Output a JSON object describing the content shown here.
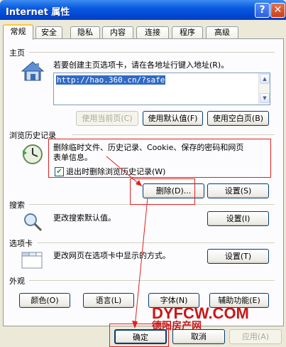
{
  "window": {
    "title": "Internet 属性",
    "help_label": "?",
    "close_label": "✕"
  },
  "tabs": [
    "常规",
    "安全",
    "隐私",
    "内容",
    "连接",
    "程序",
    "高级"
  ],
  "homepage": {
    "group_title": "主页",
    "description": "若要创建主页选项卡，请在各地址行键入地址(R)。",
    "url": "http://hao.360.cn/?safe",
    "btn_current": "使用当前页(C)",
    "btn_default": "使用默认值(F)",
    "btn_blank": "使用空白页(B)"
  },
  "history": {
    "group_title": "浏览历史记录",
    "description_line1": "删除临时文件、历史记录、Cookie、保存的密码和网页",
    "description_line2": "表单信息。",
    "checkbox_label": "退出时删除浏览历史记录(W)",
    "checkbox_checked": true,
    "btn_delete": "删除(D)...",
    "btn_settings": "设置(S)"
  },
  "search": {
    "group_title": "搜索",
    "description": "更改搜索默认值。",
    "btn_settings": "设置(I)"
  },
  "tabs_section": {
    "group_title": "选项卡",
    "description": "更改网页在选项卡中显示的方式。",
    "btn_settings": "设置(T)"
  },
  "appearance": {
    "group_title": "外观",
    "btn_colors": "颜色(O)",
    "btn_languages": "语言(L)",
    "btn_fonts": "字体(N)",
    "btn_accessibility": "辅助功能(E)"
  },
  "footer": {
    "ok": "确定",
    "cancel": "取消",
    "apply": "应用(A)"
  },
  "watermark": {
    "main": "DYFCW.COM",
    "sub": "德阳房产网"
  },
  "colors": {
    "annotation_red": "#e02020",
    "titlebar_blue": "#0a5ae0",
    "dialog_bg": "#ece9d8"
  }
}
